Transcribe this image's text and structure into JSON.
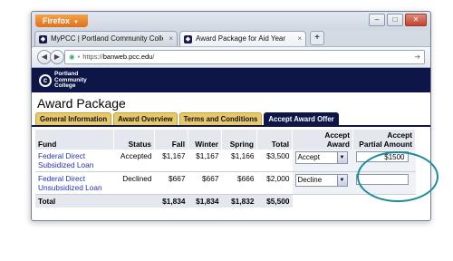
{
  "browser": {
    "menu_label": "Firefox",
    "tabs": [
      {
        "label": "MyPCC | Portland Community College"
      },
      {
        "label": "Award Package for Aid Year"
      }
    ],
    "new_tab_label": "+",
    "url_prefix": "https://",
    "url_domain": "banweb.pcc.edu",
    "url_suffix": "/"
  },
  "site": {
    "logo_line1": "Portland",
    "logo_line2": "Community",
    "logo_line3": "College"
  },
  "page": {
    "title": "Award Package",
    "tabs": [
      "General Information",
      "Award Overview",
      "Terms and Conditions",
      "Accept Award Offer"
    ],
    "active_tab_index": 3
  },
  "table": {
    "headers": {
      "fund": "Fund",
      "status": "Status",
      "fall": "Fall",
      "winter": "Winter",
      "spring": "Spring",
      "total": "Total",
      "accept_award_1": "Accept",
      "accept_award_2": "Award",
      "accept_partial_1": "Accept",
      "accept_partial_2": "Partial Amount"
    },
    "rows": [
      {
        "fund_1": "Federal Direct",
        "fund_2": "Subsidized Loan",
        "status": "Accepted",
        "fall": "$1,167",
        "winter": "$1,167",
        "spring": "$1,166",
        "total": "$3,500",
        "award": "Accept",
        "partial": "$1500"
      },
      {
        "fund_1": "Federal Direct",
        "fund_2": "Unsubsidized Loan",
        "status": "Declined",
        "fall": "$667",
        "winter": "$667",
        "spring": "$666",
        "total": "$2,000",
        "award": "Decline",
        "partial": ""
      }
    ],
    "total_row": {
      "label": "Total",
      "fall": "$1,834",
      "winter": "$1,834",
      "spring": "$1,832",
      "total": "$5,500"
    }
  },
  "colors": {
    "banner": "#0d1646",
    "tab_gold": "#e7c86a",
    "link": "#2234b5",
    "highlight_ellipse": "#1a8aa0"
  }
}
